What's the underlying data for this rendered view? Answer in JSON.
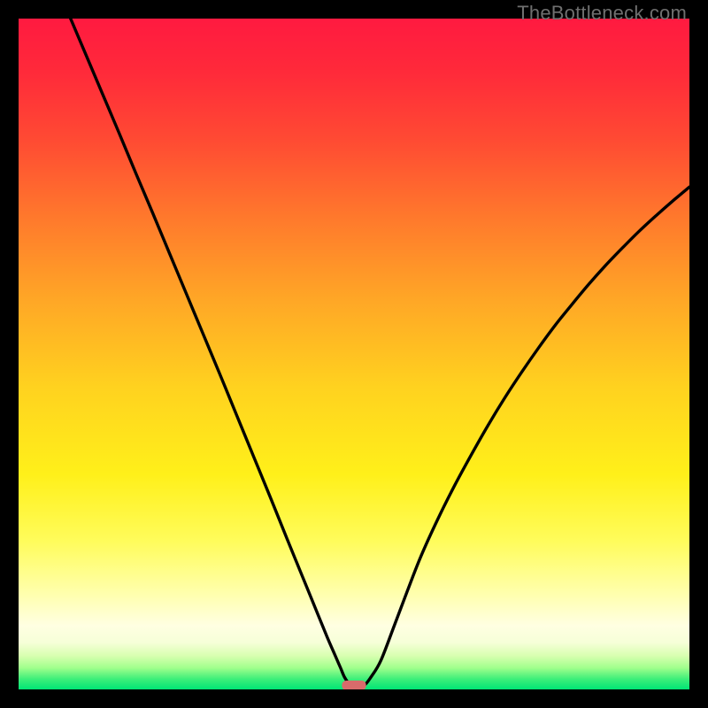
{
  "watermark": "TheBottleneck.com",
  "gradient": {
    "stops": [
      {
        "offset": 0.0,
        "color": "#ff1a40"
      },
      {
        "offset": 0.08,
        "color": "#ff2a3a"
      },
      {
        "offset": 0.18,
        "color": "#ff4a33"
      },
      {
        "offset": 0.3,
        "color": "#ff7a2c"
      },
      {
        "offset": 0.42,
        "color": "#ffa726"
      },
      {
        "offset": 0.55,
        "color": "#ffd21f"
      },
      {
        "offset": 0.68,
        "color": "#fff01a"
      },
      {
        "offset": 0.78,
        "color": "#fffc5c"
      },
      {
        "offset": 0.86,
        "color": "#ffffb0"
      },
      {
        "offset": 0.905,
        "color": "#ffffe2"
      },
      {
        "offset": 0.93,
        "color": "#f6ffd8"
      },
      {
        "offset": 0.95,
        "color": "#d8ffb0"
      },
      {
        "offset": 0.968,
        "color": "#a0ff8c"
      },
      {
        "offset": 0.984,
        "color": "#40ef7a"
      },
      {
        "offset": 1.0,
        "color": "#00e575"
      }
    ]
  },
  "chart_data": {
    "type": "line",
    "title": "",
    "xlabel": "",
    "ylabel": "",
    "xlim": [
      0,
      1
    ],
    "ylim": [
      0,
      1
    ],
    "x": [
      0.0,
      0.025,
      0.05,
      0.075,
      0.1,
      0.125,
      0.15,
      0.175,
      0.2,
      0.225,
      0.25,
      0.275,
      0.3,
      0.325,
      0.35,
      0.375,
      0.4,
      0.42,
      0.44,
      0.46,
      0.47,
      0.48,
      0.486,
      0.495,
      0.505,
      0.515,
      0.525,
      0.54,
      0.56,
      0.58,
      0.6,
      0.625,
      0.65,
      0.675,
      0.7,
      0.725,
      0.75,
      0.775,
      0.8,
      0.825,
      0.85,
      0.875,
      0.9,
      0.925,
      0.95,
      0.975,
      1.0
    ],
    "values": [
      null,
      null,
      null,
      1.006,
      0.947,
      0.888,
      0.829,
      0.769,
      0.71,
      0.65,
      0.59,
      0.53,
      0.47,
      0.409,
      0.348,
      0.287,
      0.225,
      0.176,
      0.127,
      0.078,
      0.055,
      0.032,
      0.018,
      0.006,
      0.006,
      0.006,
      0.018,
      0.043,
      0.095,
      0.148,
      0.199,
      0.254,
      0.304,
      0.35,
      0.394,
      0.435,
      0.473,
      0.509,
      0.543,
      0.574,
      0.604,
      0.632,
      0.658,
      0.683,
      0.706,
      0.728,
      0.749
    ],
    "minimum_marker": {
      "x_center": 0.5,
      "x_halfwidth": 0.018,
      "y_center": 0.006,
      "color": "#d96b6b"
    }
  },
  "curve_style": {
    "stroke": "#000000",
    "stroke_width": 3.4
  }
}
